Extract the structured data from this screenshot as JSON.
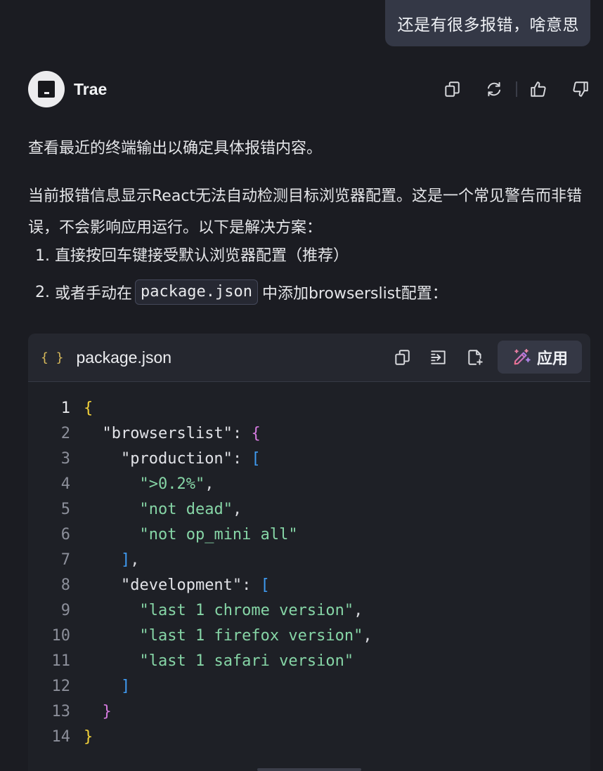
{
  "user_message": "还是有很多报错，啥意思",
  "assistant": {
    "name": "Trae",
    "actions": [
      {
        "icon": "copy-icon"
      },
      {
        "icon": "regenerate-icon"
      },
      {
        "icon": "thumbs-up-icon"
      },
      {
        "icon": "thumbs-down-icon"
      }
    ]
  },
  "message": {
    "p1": "查看最近的终端输出以确定具体报错内容。",
    "p2": "当前报错信息显示React无法自动检测目标浏览器配置。这是一个常见警告而非错误，不会影响应用运行。以下是解决方案：",
    "list": [
      {
        "num": "1.",
        "text": "直接按回车键接受默认浏览器配置（推荐）"
      },
      {
        "num": "2.",
        "prefix": "或者手动在",
        "code": "package.json",
        "suffix": "中添加browserslist配置："
      }
    ]
  },
  "code_block": {
    "icon": "{ }",
    "filename": "package.json",
    "apply_label": "应用",
    "tool_icons": [
      "copy-icon",
      "insert-at-cursor-icon",
      "add-to-file-icon",
      "apply-icon"
    ],
    "lines": [
      {
        "n": "1",
        "tokens": [
          {
            "t": "{",
            "c": "t-b1"
          }
        ]
      },
      {
        "n": "2",
        "tokens": [
          {
            "t": "  ",
            "c": ""
          },
          {
            "t": "\"browserslist\"",
            "c": "t-key"
          },
          {
            "t": ": ",
            "c": "t-punc"
          },
          {
            "t": "{",
            "c": "t-b2"
          }
        ]
      },
      {
        "n": "3",
        "tokens": [
          {
            "t": "    ",
            "c": ""
          },
          {
            "t": "\"production\"",
            "c": "t-key"
          },
          {
            "t": ": ",
            "c": "t-punc"
          },
          {
            "t": "[",
            "c": "t-b3"
          }
        ]
      },
      {
        "n": "4",
        "tokens": [
          {
            "t": "      ",
            "c": ""
          },
          {
            "t": "\">0.2%\"",
            "c": "t-str"
          },
          {
            "t": ",",
            "c": "t-punc"
          }
        ]
      },
      {
        "n": "5",
        "tokens": [
          {
            "t": "      ",
            "c": ""
          },
          {
            "t": "\"not dead\"",
            "c": "t-str"
          },
          {
            "t": ",",
            "c": "t-punc"
          }
        ]
      },
      {
        "n": "6",
        "tokens": [
          {
            "t": "      ",
            "c": ""
          },
          {
            "t": "\"not op_mini all\"",
            "c": "t-str"
          }
        ]
      },
      {
        "n": "7",
        "tokens": [
          {
            "t": "    ",
            "c": ""
          },
          {
            "t": "]",
            "c": "t-b3"
          },
          {
            "t": ",",
            "c": "t-punc"
          }
        ]
      },
      {
        "n": "8",
        "tokens": [
          {
            "t": "    ",
            "c": ""
          },
          {
            "t": "\"development\"",
            "c": "t-key"
          },
          {
            "t": ": ",
            "c": "t-punc"
          },
          {
            "t": "[",
            "c": "t-b3"
          }
        ]
      },
      {
        "n": "9",
        "tokens": [
          {
            "t": "      ",
            "c": ""
          },
          {
            "t": "\"last 1 chrome version\"",
            "c": "t-str"
          },
          {
            "t": ",",
            "c": "t-punc"
          }
        ]
      },
      {
        "n": "10",
        "tokens": [
          {
            "t": "      ",
            "c": ""
          },
          {
            "t": "\"last 1 firefox version\"",
            "c": "t-str"
          },
          {
            "t": ",",
            "c": "t-punc"
          }
        ]
      },
      {
        "n": "11",
        "tokens": [
          {
            "t": "      ",
            "c": ""
          },
          {
            "t": "\"last 1 safari version\"",
            "c": "t-str"
          }
        ]
      },
      {
        "n": "12",
        "tokens": [
          {
            "t": "    ",
            "c": ""
          },
          {
            "t": "]",
            "c": "t-b3"
          }
        ]
      },
      {
        "n": "13",
        "tokens": [
          {
            "t": "  ",
            "c": ""
          },
          {
            "t": "}",
            "c": "t-b2"
          }
        ]
      },
      {
        "n": "14",
        "tokens": [
          {
            "t": "}",
            "c": "t-b1"
          }
        ]
      }
    ],
    "current_line": "1"
  },
  "colors": {
    "background": "#1b1c22",
    "bubble": "#343846",
    "string": "#86d5a6",
    "bracket_level1": "#f3d23a",
    "bracket_level2": "#d67be0",
    "bracket_level3": "#3f9af0",
    "apply_icon_gradient": [
      "#f0708c",
      "#a77bf0"
    ]
  }
}
